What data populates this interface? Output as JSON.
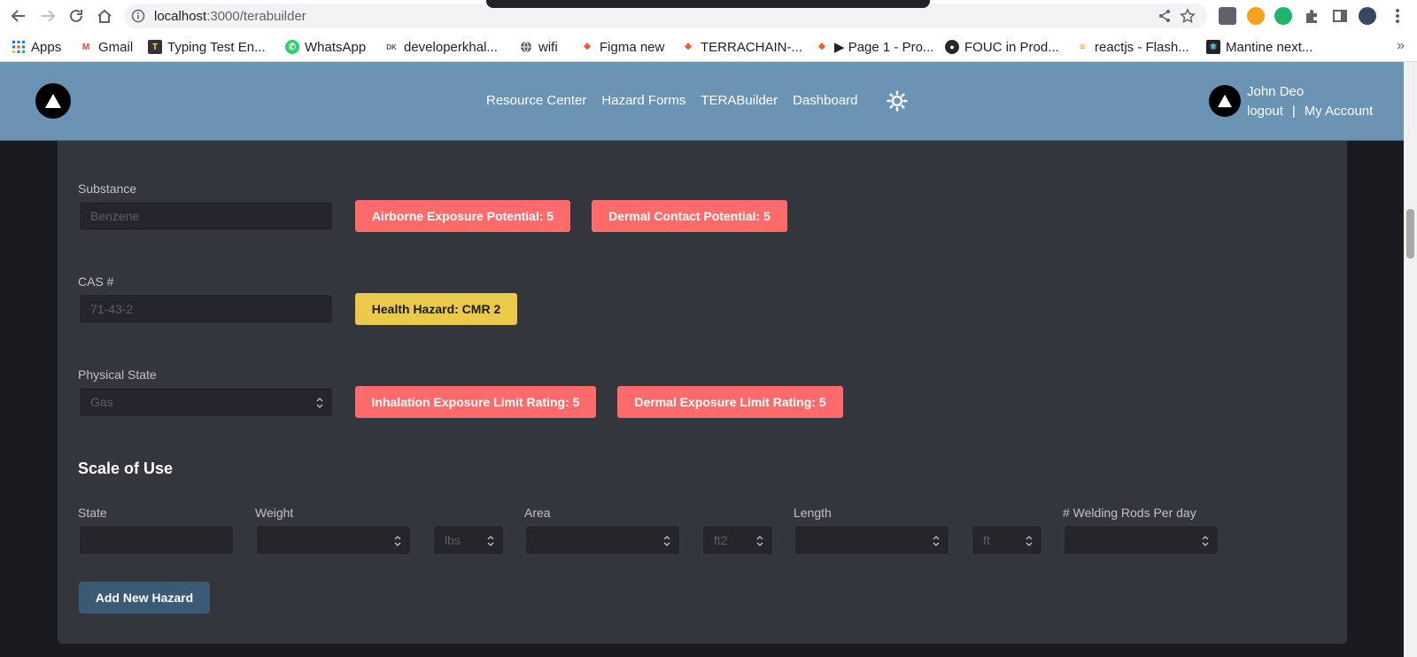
{
  "browser": {
    "url_host": "localhost",
    "url_path": ":3000/terabuilder",
    "bookmarks": [
      {
        "label": "Apps",
        "icon": "apps-grid-icon"
      },
      {
        "label": "Gmail",
        "icon": "gmail-icon"
      },
      {
        "label": "Typing Test En...",
        "icon": "typing-test-icon"
      },
      {
        "label": "WhatsApp",
        "icon": "whatsapp-icon"
      },
      {
        "label": "developerkhal...",
        "icon": "dev-icon"
      },
      {
        "label": "wifi",
        "icon": "globe-icon"
      },
      {
        "label": "Figma new",
        "icon": "figma-icon"
      },
      {
        "label": "TERRACHAIN-...",
        "icon": "figma-icon"
      },
      {
        "label": "▶ Page 1 - Pro...",
        "icon": "figma-icon"
      },
      {
        "label": "FOUC in Prod...",
        "icon": "github-icon"
      },
      {
        "label": "reactjs - Flash...",
        "icon": "stackoverflow-icon"
      },
      {
        "label": "Mantine next...",
        "icon": "react-icon"
      }
    ],
    "more_bookmarks": "»"
  },
  "header": {
    "nav": [
      "Resource Center",
      "Hazard Forms",
      "TERABuilder",
      "Dashboard"
    ],
    "user_name": "John Deo",
    "logout": "logout",
    "separator": "|",
    "account": "My Account",
    "bg_color": "#6b93b4"
  },
  "form": {
    "substance": {
      "label": "Substance",
      "placeholder": "Benzene"
    },
    "cas": {
      "label": "CAS #",
      "placeholder": "71-43-2"
    },
    "physical_state": {
      "label": "Physical State",
      "value": "Gas"
    },
    "badges": {
      "airborne": "Airborne Exposure Potential: 5",
      "dermal_contact": "Dermal Contact Potential: 5",
      "health": "Health Hazard: CMR 2",
      "inhalation": "Inhalation Exposure Limit Rating: 5",
      "dermal_limit": "Dermal Exposure Limit Rating: 5"
    },
    "scale_title": "Scale of Use",
    "scale": {
      "state_label": "State",
      "weight_label": "Weight",
      "weight_unit": "lbs",
      "area_label": "Area",
      "area_unit": "ft2",
      "length_label": "Length",
      "length_unit": "ft",
      "rods_label": "# Welding Rods Per day"
    },
    "add_button": "Add New Hazard"
  },
  "colors": {
    "red_badge": "#ff6b6b",
    "yellow_badge": "#ebc94a",
    "button": "#3b5a76"
  }
}
